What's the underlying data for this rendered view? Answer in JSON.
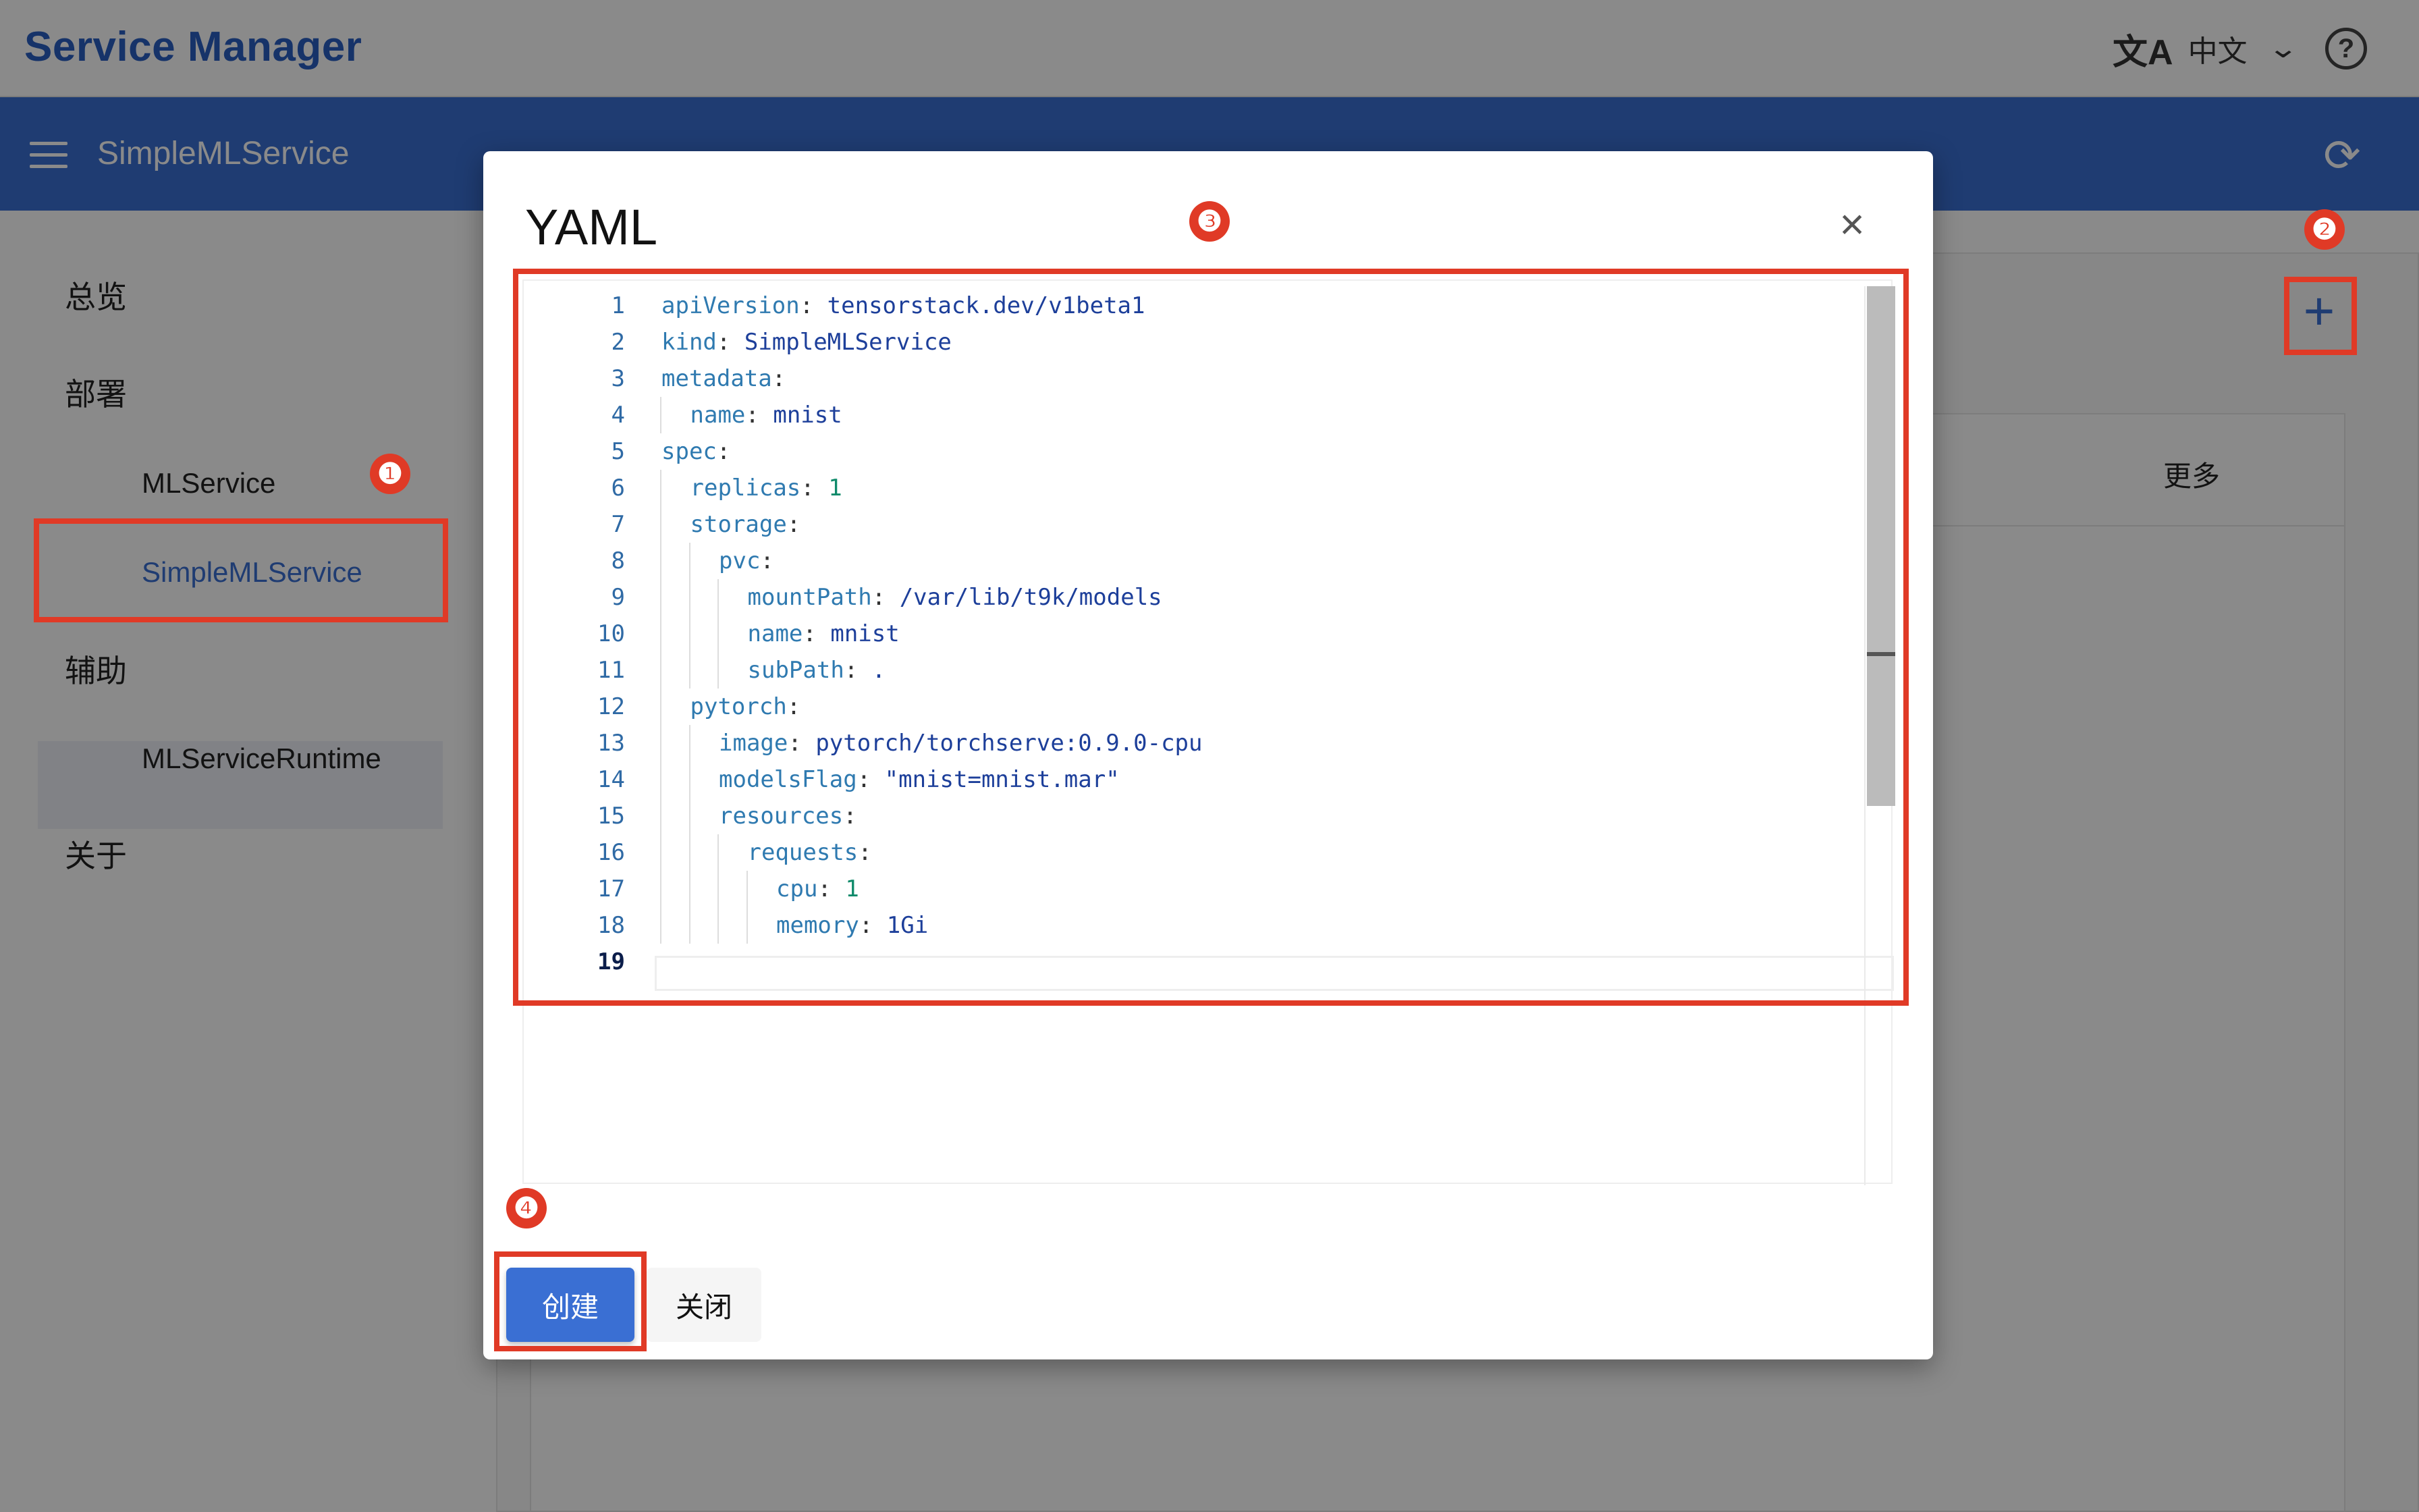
{
  "header": {
    "app_title": "Service Manager",
    "language_label": "中文",
    "translate_icon": "translate-icon",
    "help_icon": "help-circle-icon"
  },
  "navbar": {
    "menu_icon": "menu-icon",
    "title": "SimpleMLService",
    "refresh_icon": "refresh-icon"
  },
  "sidebar": {
    "groups": [
      {
        "label": "总览"
      },
      {
        "label": "部署",
        "items": [
          {
            "label": "MLService"
          },
          {
            "label": "SimpleMLService",
            "active": true
          }
        ]
      },
      {
        "label": "辅助",
        "items": [
          {
            "label": "MLServiceRuntime"
          }
        ]
      },
      {
        "label": "关于"
      }
    ]
  },
  "main": {
    "table_more_label": "更多",
    "add_button": "+"
  },
  "dialog": {
    "title": "YAML",
    "close_icon": "×",
    "create_label": "创建",
    "close_label": "关闭",
    "code_lines": [
      {
        "no": "1",
        "indent": 0,
        "key": "apiVersion",
        "value": "tensorstack.dev/v1beta1",
        "vtype": "v"
      },
      {
        "no": "2",
        "indent": 0,
        "key": "kind",
        "value": "SimpleMLService",
        "vtype": "v"
      },
      {
        "no": "3",
        "indent": 0,
        "key": "metadata",
        "value": "",
        "vtype": "v"
      },
      {
        "no": "4",
        "indent": 1,
        "key": "name",
        "value": "mnist",
        "vtype": "v"
      },
      {
        "no": "5",
        "indent": 0,
        "key": "spec",
        "value": "",
        "vtype": "v"
      },
      {
        "no": "6",
        "indent": 1,
        "key": "replicas",
        "value": "1",
        "vtype": "n"
      },
      {
        "no": "7",
        "indent": 1,
        "key": "storage",
        "value": "",
        "vtype": "v"
      },
      {
        "no": "8",
        "indent": 2,
        "key": "pvc",
        "value": "",
        "vtype": "v"
      },
      {
        "no": "9",
        "indent": 3,
        "key": "mountPath",
        "value": "/var/lib/t9k/models",
        "vtype": "v"
      },
      {
        "no": "10",
        "indent": 3,
        "key": "name",
        "value": "mnist",
        "vtype": "v"
      },
      {
        "no": "11",
        "indent": 3,
        "key": "subPath",
        "value": ".",
        "vtype": "v"
      },
      {
        "no": "12",
        "indent": 1,
        "key": "pytorch",
        "value": "",
        "vtype": "v"
      },
      {
        "no": "13",
        "indent": 2,
        "key": "image",
        "value": "pytorch/torchserve:0.9.0-cpu",
        "vtype": "v"
      },
      {
        "no": "14",
        "indent": 2,
        "key": "modelsFlag",
        "value": "\"mnist=mnist.mar\"",
        "vtype": "s"
      },
      {
        "no": "15",
        "indent": 2,
        "key": "resources",
        "value": "",
        "vtype": "v"
      },
      {
        "no": "16",
        "indent": 3,
        "key": "requests",
        "value": "",
        "vtype": "v"
      },
      {
        "no": "17",
        "indent": 4,
        "key": "cpu",
        "value": "1",
        "vtype": "n"
      },
      {
        "no": "18",
        "indent": 4,
        "key": "memory",
        "value": "1Gi",
        "vtype": "v"
      },
      {
        "no": "19",
        "indent": 0,
        "key": "",
        "value": "",
        "vtype": "v"
      }
    ]
  },
  "annotations": {
    "badges": [
      "❶",
      "❷",
      "❸",
      "❹"
    ],
    "color": "#e03a26"
  },
  "colors": {
    "primary": "#3a6fd3",
    "annotation_red": "#e03a26"
  }
}
